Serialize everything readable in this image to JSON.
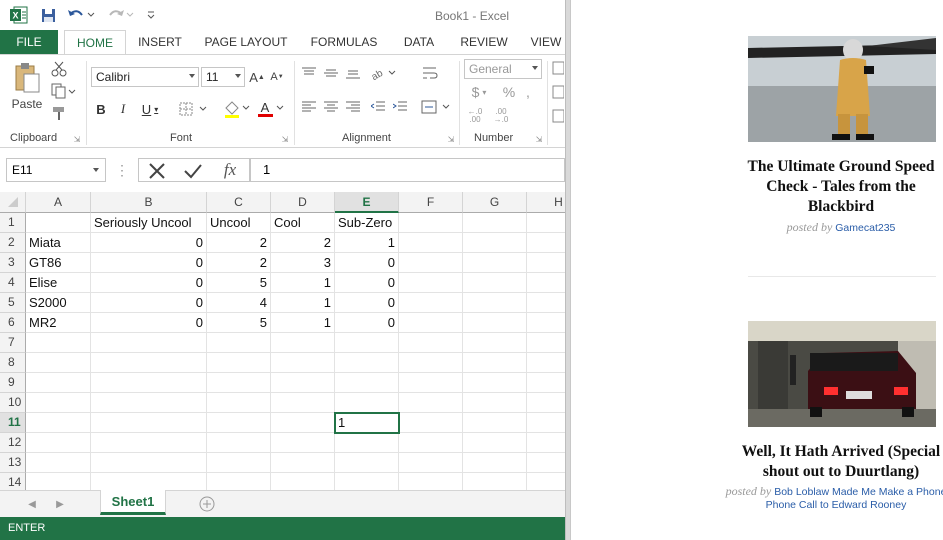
{
  "excel": {
    "title": "Book1 - Excel",
    "tabs": [
      "FILE",
      "HOME",
      "INSERT",
      "PAGE LAYOUT",
      "FORMULAS",
      "DATA",
      "REVIEW",
      "VIEW"
    ],
    "ribbon": {
      "paste_label": "Paste",
      "font_name": "Calibri",
      "font_size": "11",
      "number_format": "General",
      "groups": [
        "Clipboard",
        "Font",
        "Alignment",
        "Number"
      ]
    },
    "name_box": "E11",
    "formula_value": "1",
    "columns": [
      "A",
      "B",
      "C",
      "D",
      "E",
      "F",
      "G",
      "H"
    ],
    "rows": [
      "1",
      "2",
      "3",
      "4",
      "5",
      "6",
      "7",
      "8",
      "9",
      "10",
      "11",
      "12",
      "13",
      "14"
    ],
    "headers": [
      "",
      "Seriously Uncool",
      "Uncool",
      "Cool",
      "Sub-Zero"
    ],
    "data": [
      {
        "car": "Miata",
        "vals": [
          "0",
          "2",
          "2",
          "1"
        ]
      },
      {
        "car": "GT86",
        "vals": [
          "0",
          "2",
          "3",
          "0"
        ]
      },
      {
        "car": "Elise",
        "vals": [
          "0",
          "5",
          "1",
          "0"
        ]
      },
      {
        "car": "S2000",
        "vals": [
          "0",
          "4",
          "1",
          "0"
        ]
      },
      {
        "car": "MR2",
        "vals": [
          "0",
          "5",
          "1",
          "0"
        ]
      }
    ],
    "e11_value": "1",
    "sheet_tab": "Sheet1",
    "status": "ENTER"
  },
  "blog": {
    "posts": [
      {
        "title_lines": [
          "The Ultimate Ground Speed",
          "Check - Tales from the",
          "Blackbird"
        ],
        "posted_by": "posted by",
        "author": "Gamecat235"
      },
      {
        "title_lines": [
          "Well, It Hath Arrived (Special",
          "shout out to Duurtlang)"
        ],
        "posted_by": "posted by",
        "author_lines": [
          "Bob Loblaw Made Me Make a Phone",
          "Phone Call to Edward Rooney"
        ]
      }
    ]
  }
}
